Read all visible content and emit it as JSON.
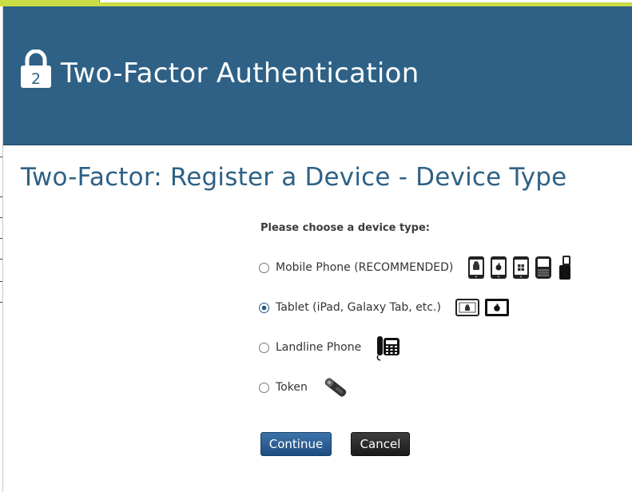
{
  "header": {
    "title": "Two-Factor Authentication",
    "lock_number": "2"
  },
  "page_title": "Two-Factor: Register a Device - Device Type",
  "prompt": "Please choose a device type:",
  "options": [
    {
      "label": "Mobile Phone (RECOMMENDED)",
      "checked": false,
      "icons": [
        "android-phone-icon",
        "iphone-icon",
        "windows-phone-icon",
        "blackberry-icon",
        "flip-phone-icon"
      ]
    },
    {
      "label": "Tablet (iPad, Galaxy Tab, etc.)",
      "checked": true,
      "icons": [
        "android-tablet-icon",
        "ipad-icon"
      ]
    },
    {
      "label": "Landline Phone",
      "checked": false,
      "icons": [
        "desk-phone-icon"
      ]
    },
    {
      "label": "Token",
      "checked": false,
      "icons": [
        "token-key-icon"
      ]
    }
  ],
  "buttons": {
    "continue": "Continue",
    "cancel": "Cancel"
  },
  "colors": {
    "header_bg": "#2e6185",
    "title_blue": "#2e6185",
    "continue_bg": "#1f4d80",
    "cancel_bg": "#1b1b1b",
    "top_strip": "#c9dc46"
  }
}
